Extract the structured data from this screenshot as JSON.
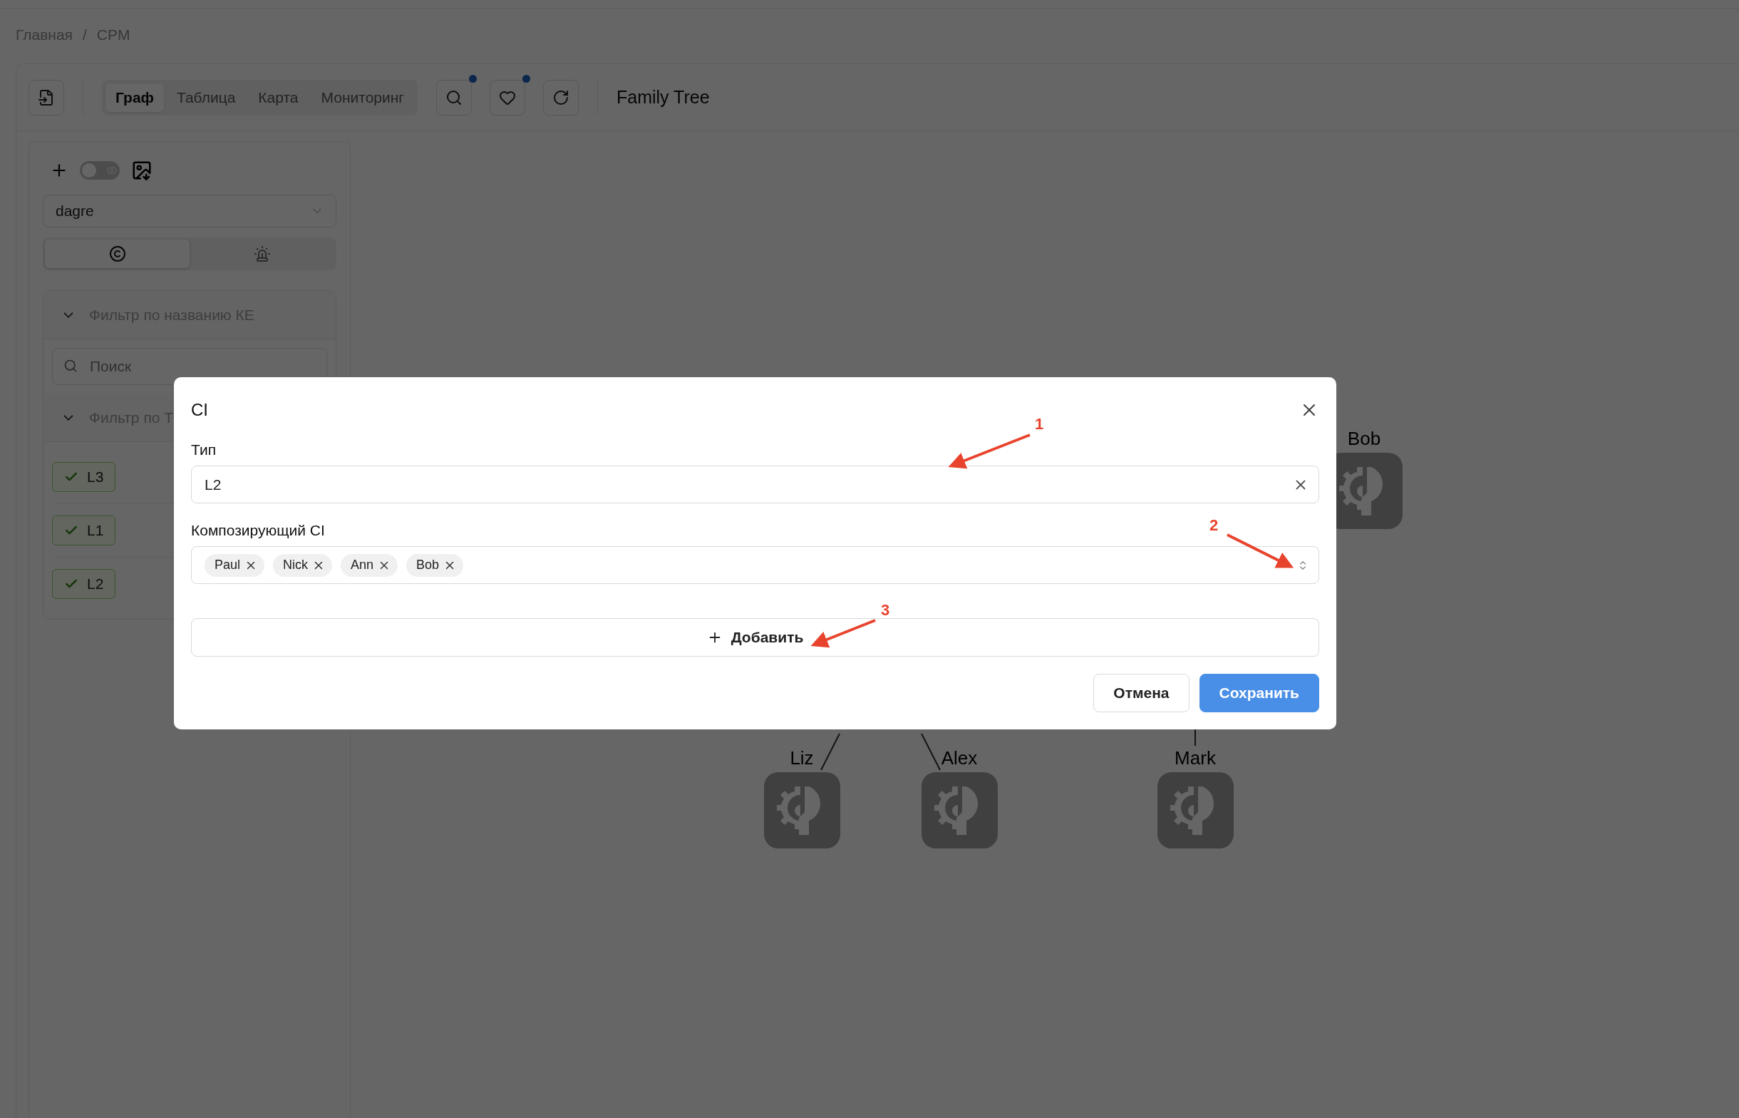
{
  "breadcrumb": {
    "items": [
      "Главная",
      "CPM"
    ],
    "separator": "/"
  },
  "toolbar": {
    "view_tabs": [
      {
        "label": "Граф",
        "selected": true
      },
      {
        "label": "Таблица",
        "selected": false
      },
      {
        "label": "Карта",
        "selected": false
      },
      {
        "label": "Мониторинг",
        "selected": false
      }
    ],
    "tool_buttons": [
      {
        "kind": "search",
        "dot": true
      },
      {
        "kind": "heart-search",
        "dot": true
      },
      {
        "kind": "refresh",
        "dot": false
      }
    ],
    "title": "Family Tree"
  },
  "sidebar": {
    "visibility_toggle": {
      "on": false
    },
    "layout_select": "dagre",
    "mode_tabs": [
      {
        "kind": "ci",
        "selected": true
      },
      {
        "kind": "alarm",
        "selected": false
      }
    ],
    "filters": [
      {
        "title": "Фильтр по названию КЕ",
        "expanded": true,
        "search_placeholder": "Поиск"
      },
      {
        "title": "Фильтр по Т",
        "expanded": true,
        "tags": [
          {
            "label": "L3",
            "checked": true
          },
          {
            "label": "L1",
            "checked": true
          },
          {
            "label": "L2",
            "checked": true
          }
        ]
      }
    ]
  },
  "graph": {
    "nodes": [
      {
        "name": "Bob"
      },
      {
        "name": "Liz"
      },
      {
        "name": "Alex"
      },
      {
        "name": "Mark"
      }
    ]
  },
  "modal": {
    "title": "CI",
    "fields": [
      {
        "kind": "select",
        "label": "Тип",
        "value": "L2",
        "clearable": true
      },
      {
        "kind": "multiselect",
        "label": "Композирующий CI",
        "tags": [
          "Paul",
          "Nick",
          "Ann",
          "Bob"
        ]
      }
    ],
    "add_button": "Добавить",
    "buttons": [
      {
        "label": "Отмена",
        "primary": false
      },
      {
        "label": "Сохранить",
        "primary": true
      }
    ]
  },
  "annotations": [
    {
      "label": "1"
    },
    {
      "label": "2"
    },
    {
      "label": "3"
    }
  ]
}
